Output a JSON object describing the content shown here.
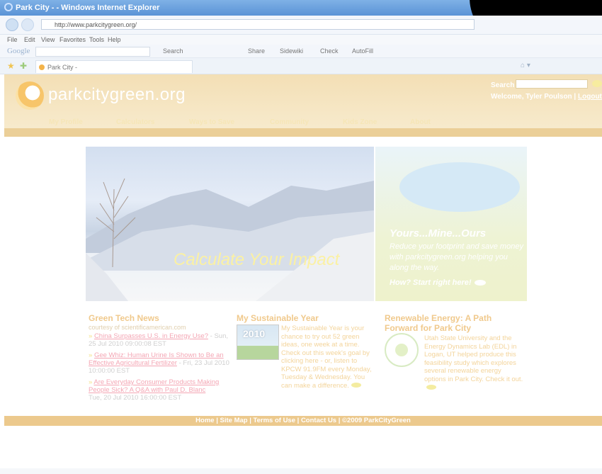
{
  "browser": {
    "window_title": "Park City - - Windows Internet Explorer",
    "url": "http://www.parkcitygreen.org/",
    "menu": [
      "File",
      "Edit",
      "View",
      "Favorites",
      "Tools",
      "Help"
    ],
    "google_label": "Google",
    "toolbar": [
      "Search",
      "Share",
      "Sidewiki",
      "Check",
      "AutoFill"
    ],
    "tab_title": "Park City -"
  },
  "site": {
    "name": "parkcitygreen.org",
    "search_label": "Search",
    "search_value": "",
    "welcome_prefix": "Welcome, Tyler Poulson |",
    "logout_label": "Logout",
    "nav": [
      "My Profile",
      "Calculators",
      "Ways to Save",
      "Community",
      "Kids Zone",
      "About"
    ]
  },
  "hero": {
    "text": "Calculate Your Impact"
  },
  "promo": {
    "heading": "Yours...Mine...Ours",
    "body": "Reduce your footprint and save money with parkcitygreen.org helping you along the way.",
    "cta": "How? Start right here!"
  },
  "news": {
    "title": "Green Tech News",
    "subtitle": "courtesy of scientificamerican.com",
    "items": [
      {
        "link": "China Surpasses U.S. in Energy Use?",
        "date": "- Sun, 25 Jul 2010 09:00:08 EST"
      },
      {
        "link": "Gee Whiz: Human Urine Is Shown to Be an Effective Agricultural Fertilizer",
        "date": "- Fri, 23 Jul 2010 10:00:00 EST"
      },
      {
        "link": "Are Everyday Consumer Products Making People Sick? A Q&A with Paul D. Blanc",
        "date": "Tue, 20 Jul 2010 16:00:00 EST"
      }
    ]
  },
  "year": {
    "title": "My Sustainable Year",
    "badge": "2010",
    "text": "My Sustainable Year is your chance to try out 52 green ideas, one week at a time. Check out this week's goal by clicking here - or, listen to KPCW 91.9FM every Monday, Tuesday & Wednesday. You can make a difference."
  },
  "renew": {
    "title": "Renewable Energy: A Path Forward for Park City",
    "text": "Utah State University and the Energy Dynamics Lab (EDL) in Logan, UT helped produce this feasibility study which explores several renewable energy options in Park City. Check it out."
  },
  "footer": {
    "links": [
      "Home",
      "Site Map",
      "Terms of Use",
      "Contact Us"
    ],
    "copyright": "©2009 ParkCityGreen"
  }
}
